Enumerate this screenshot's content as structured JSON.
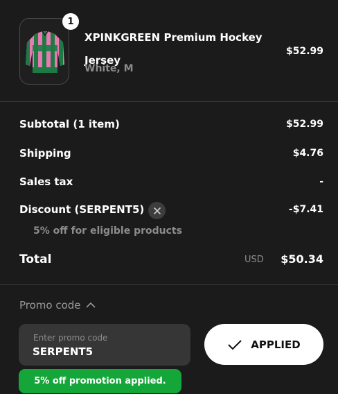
{
  "product": {
    "quantity": "1",
    "name": "XPINKGREEN Premium Hockey Jersey",
    "variant": "White, M",
    "price": "$52.99",
    "image_icon": "jersey-image"
  },
  "summary": {
    "subtotal_label": "Subtotal (1 item)",
    "subtotal_value": "$52.99",
    "shipping_label": "Shipping",
    "shipping_value": "$4.76",
    "tax_label": "Sales tax",
    "tax_value": "-",
    "discount_label": "Discount (SERPENT5)",
    "discount_value": "-$7.41",
    "discount_note": "5% off for eligible products",
    "total_label": "Total",
    "currency": "USD",
    "total_value": "$50.34"
  },
  "promo": {
    "toggle_label": "Promo code",
    "placeholder": "Enter promo code",
    "value": "SERPENT5",
    "button_label": "APPLIED",
    "success_message": "5% off promotion applied."
  },
  "colors": {
    "background": "#1b1b1b",
    "success": "#15a63a",
    "jersey_pink": "#e879b1",
    "jersey_green": "#1e7a45"
  }
}
